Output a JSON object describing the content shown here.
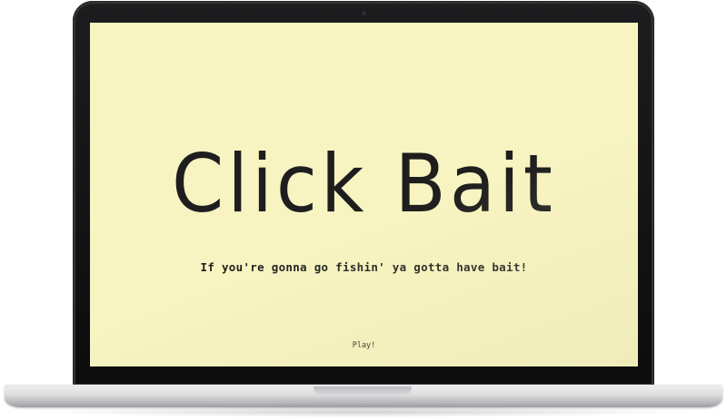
{
  "game": {
    "title": "Click Bait",
    "tagline": "If you're gonna go fishin' ya gotta have bait!",
    "play_label": "Play!",
    "background_color": "#f7f4c1",
    "text_color": "#1e1e1e"
  }
}
